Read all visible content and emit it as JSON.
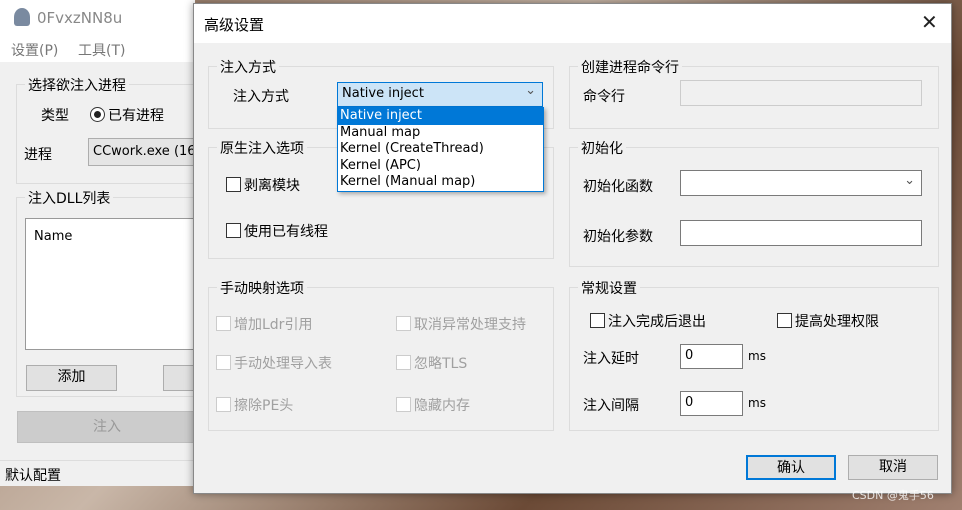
{
  "main_window": {
    "title": "0FvxzNN8u",
    "menu": [
      "设置(P)",
      "工具(T)"
    ],
    "process_group": {
      "label": "选择欲注入进程",
      "type_label": "类型",
      "radio_existing": "已有进程",
      "process_label": "进程",
      "process_value": "CCwork.exe (16"
    },
    "dll_group": {
      "label": "注入DLL列表",
      "column_name": "Name",
      "add_button": "添加"
    },
    "inject_button": "注入",
    "status": "默认配置"
  },
  "dialog": {
    "title": "高级设置",
    "inject_method": {
      "group": "注入方式",
      "label": "注入方式",
      "selected": "Native inject",
      "options": [
        "Native inject",
        "Manual map",
        "Kernel (CreateThread)",
        "Kernel (APC)",
        "Kernel (Manual map)"
      ]
    },
    "cmdline": {
      "group": "创建进程命令行",
      "label": "命令行",
      "value": ""
    },
    "native": {
      "group": "原生注入选项",
      "unlink": "剥离模块",
      "existing_thread": "使用已有线程"
    },
    "init": {
      "group": "初始化",
      "func_label": "初始化函数",
      "func_value": "",
      "arg_label": "初始化参数",
      "arg_value": ""
    },
    "manual": {
      "group": "手动映射选项",
      "items": [
        "增加Ldr引用",
        "取消异常处理支持",
        "手动处理导入表",
        "忽略TLS",
        "擦除PE头",
        "隐藏内存"
      ]
    },
    "general": {
      "group": "常规设置",
      "exit_after": "注入完成后退出",
      "elevate": "提高处理权限",
      "delay_label": "注入延时",
      "delay_value": "0",
      "interval_label": "注入间隔",
      "interval_value": "0",
      "unit": "ms"
    },
    "ok": "确认",
    "cancel": "取消"
  },
  "watermark": "CSDN @鬼手56",
  "colors": {
    "accent": "#0078d7",
    "selected_bg": "#cce4f7"
  }
}
